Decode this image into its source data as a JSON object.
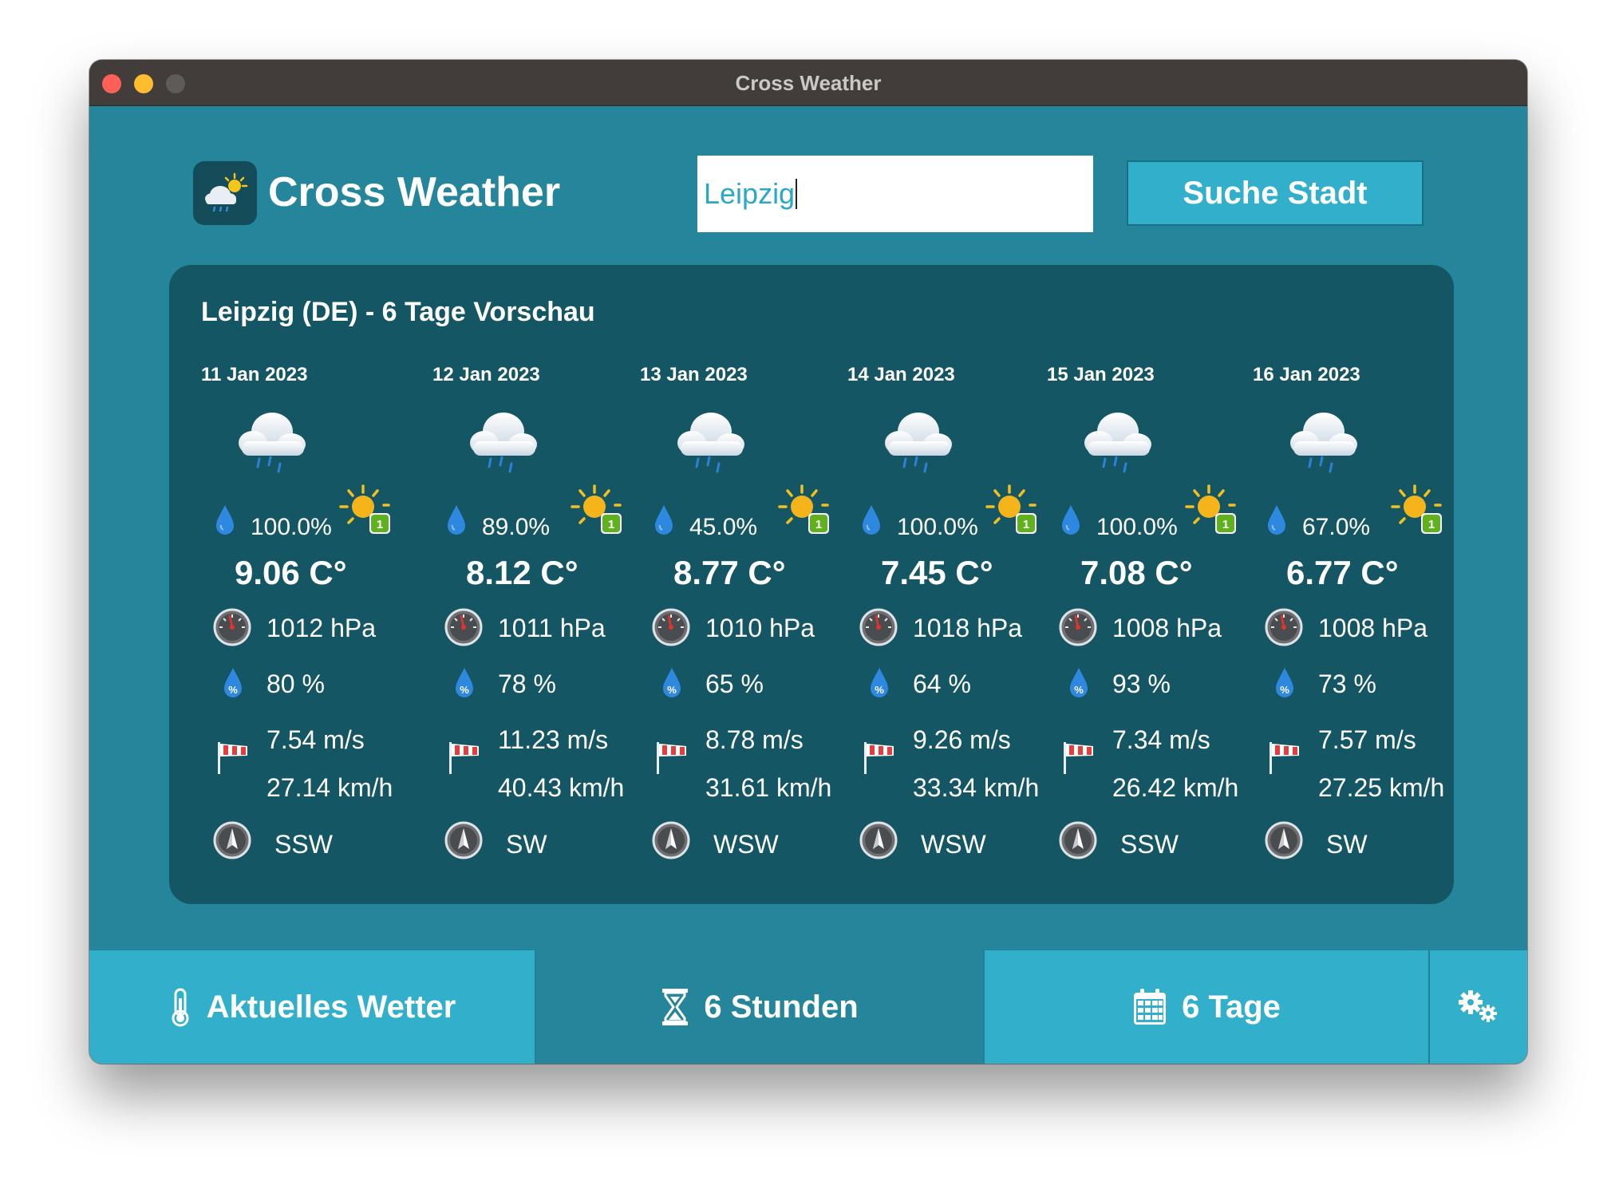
{
  "window": {
    "title": "Cross Weather"
  },
  "header": {
    "app_name": "Cross Weather",
    "logo_icon": "cloud-rain-sun-icon",
    "search": {
      "value": "Leipzig",
      "placeholder": ""
    },
    "search_button_label": "Suche Stadt"
  },
  "forecast": {
    "title": "Leipzig (DE) - 6 Tage Vorschau",
    "days": [
      {
        "date": "11 Jan 2023",
        "precipitation": "100.0%",
        "uv_index": "1",
        "temperature": "9.06 C°",
        "pressure": "1012 hPa",
        "humidity": "80 %",
        "wind_ms": "7.54 m/s",
        "wind_kmh": "27.14 km/h",
        "wind_direction": "SSW"
      },
      {
        "date": "12 Jan 2023",
        "precipitation": "89.0%",
        "uv_index": "1",
        "temperature": "8.12 C°",
        "pressure": "1011 hPa",
        "humidity": "78 %",
        "wind_ms": "11.23 m/s",
        "wind_kmh": "40.43 km/h",
        "wind_direction": "SW"
      },
      {
        "date": "13 Jan 2023",
        "precipitation": "45.0%",
        "uv_index": "1",
        "temperature": "8.77 C°",
        "pressure": "1010 hPa",
        "humidity": "65 %",
        "wind_ms": "8.78 m/s",
        "wind_kmh": "31.61 km/h",
        "wind_direction": "WSW"
      },
      {
        "date": "14 Jan 2023",
        "precipitation": "100.0%",
        "uv_index": "1",
        "temperature": "7.45 C°",
        "pressure": "1018 hPa",
        "humidity": "64 %",
        "wind_ms": "9.26 m/s",
        "wind_kmh": "33.34 km/h",
        "wind_direction": "WSW"
      },
      {
        "date": "15 Jan 2023",
        "precipitation": "100.0%",
        "uv_index": "1",
        "temperature": "7.08 C°",
        "pressure": "1008 hPa",
        "humidity": "93 %",
        "wind_ms": "7.34 m/s",
        "wind_kmh": "26.42 km/h",
        "wind_direction": "SSW"
      },
      {
        "date": "16 Jan 2023",
        "precipitation": "67.0%",
        "uv_index": "1",
        "temperature": "6.77 C°",
        "pressure": "1008 hPa",
        "humidity": "73 %",
        "wind_ms": "7.57 m/s",
        "wind_kmh": "27.25 km/h",
        "wind_direction": "SW"
      }
    ]
  },
  "tabs": {
    "current": {
      "label": "Aktuelles Wetter",
      "icon": "thermometer-icon"
    },
    "hours": {
      "label": "6 Stunden",
      "icon": "hourglass-icon",
      "selected": true
    },
    "days": {
      "label": "6 Tage",
      "icon": "calendar-icon"
    },
    "settings": {
      "icon": "gears-icon"
    }
  },
  "colors": {
    "window_bg": "#25869b",
    "panel_bg": "#155664",
    "accent": "#32afca",
    "titlebar": "#423d3b"
  }
}
